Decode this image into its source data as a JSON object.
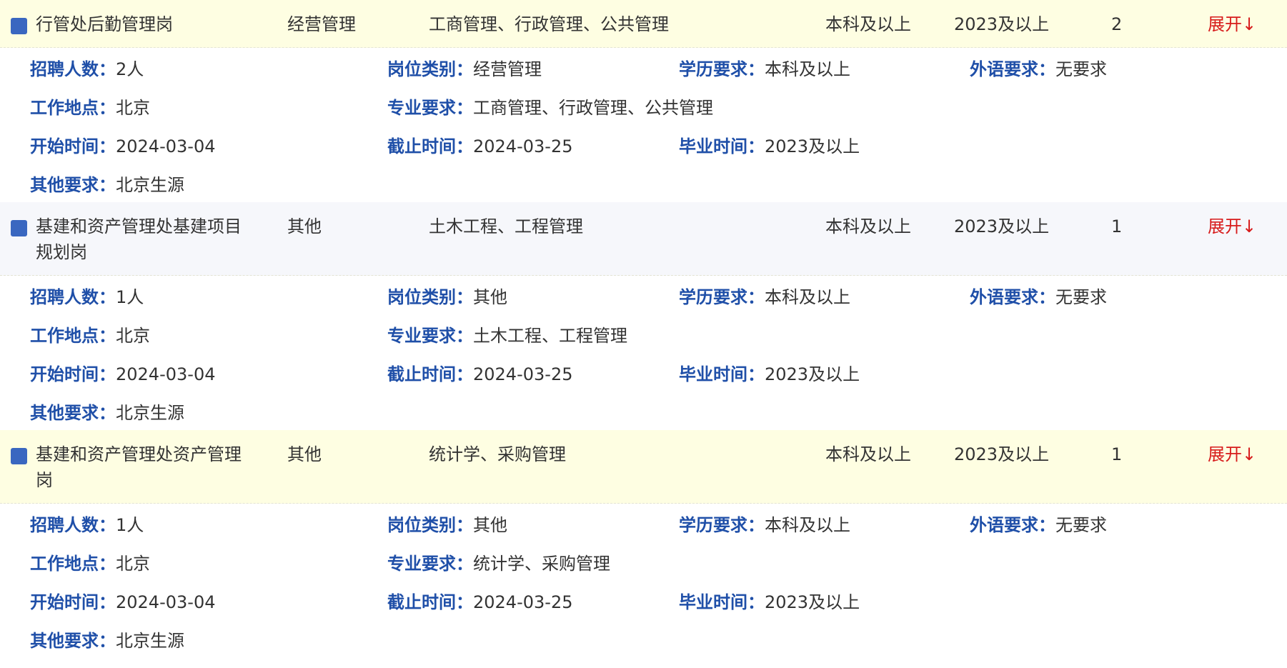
{
  "labels": {
    "count": "招聘人数：",
    "category": "岗位类别：",
    "education": "学历要求：",
    "language": "外语要求：",
    "location": "工作地点：",
    "major": "专业要求：",
    "start": "开始时间：",
    "end": "截止时间：",
    "graduation": "毕业时间：",
    "other": "其他要求："
  },
  "jobs": [
    {
      "title": "行管处后勤管理岗",
      "category": "经营管理",
      "major": "工商管理、行政管理、公共管理",
      "education": "本科及以上",
      "graduation": "2023及以上",
      "count": "2",
      "toggle": "展开↓",
      "details": {
        "count": "2人",
        "category": "经营管理",
        "education": "本科及以上",
        "language": "无要求",
        "location": "北京",
        "major": "工商管理、行政管理、公共管理",
        "start": "2024-03-04",
        "end": "2024-03-25",
        "graduation": "2023及以上",
        "other": "北京生源"
      }
    },
    {
      "title": "基建和资产管理处基建项目规划岗",
      "category": "其他",
      "major": "土木工程、工程管理",
      "education": "本科及以上",
      "graduation": "2023及以上",
      "count": "1",
      "toggle": "展开↓",
      "details": {
        "count": "1人",
        "category": "其他",
        "education": "本科及以上",
        "language": "无要求",
        "location": "北京",
        "major": "土木工程、工程管理",
        "start": "2024-03-04",
        "end": "2024-03-25",
        "graduation": "2023及以上",
        "other": "北京生源"
      }
    },
    {
      "title": "基建和资产管理处资产管理岗",
      "category": "其他",
      "major": "统计学、采购管理",
      "education": "本科及以上",
      "graduation": "2023及以上",
      "count": "1",
      "toggle": "展开↓",
      "details": {
        "count": "1人",
        "category": "其他",
        "education": "本科及以上",
        "language": "无要求",
        "location": "北京",
        "major": "统计学、采购管理",
        "start": "2024-03-04",
        "end": "2024-03-25",
        "graduation": "2023及以上",
        "other": "北京生源"
      }
    }
  ],
  "colors": {
    "row_yellow": "#fefee2",
    "row_grey": "#f6f7fb",
    "label_blue": "#1f4fa8",
    "marker_blue": "#3a67c0",
    "toggle_red": "#d71b1b"
  }
}
